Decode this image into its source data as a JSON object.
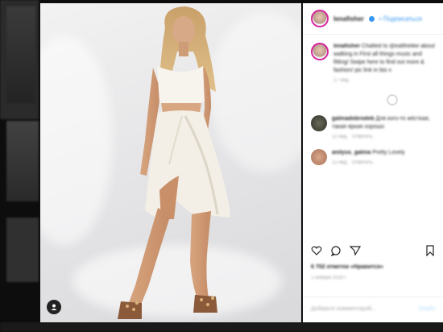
{
  "post": {
    "username": "lenafisher",
    "follow_label": "• Подписаться",
    "caption_user": "lenafisher",
    "caption_text": "Chatted to @eatthelike about walking in First all things music and fitting/ Swipe here to find out more & fashion/ pic link in bio x",
    "caption_time": "17 нед.",
    "comments": [
      {
        "user": "galinadobrodeb",
        "text": "Для кого-то жёсткая, такая яркая хорошо",
        "time": "12 нед.",
        "reply": "Ответить"
      },
      {
        "user": "anilyus_galina",
        "text": "Pretty Lovely",
        "time": "12 нед.",
        "reply": "Ответить"
      }
    ],
    "likes": "6 702 отметок «Нравится»",
    "date": "1 ноября 2019 г.",
    "add_comment_placeholder": "Добавьте комментарий...",
    "publish_label": "Опубл."
  },
  "colors": {
    "link": "#3897f0",
    "ring": "#d6249f",
    "like_red": "#ed4956"
  },
  "icons": [
    "person-icon",
    "heart-icon",
    "comment-icon",
    "share-icon",
    "bookmark-icon",
    "verified-badge-icon",
    "loading-spinner-icon"
  ]
}
